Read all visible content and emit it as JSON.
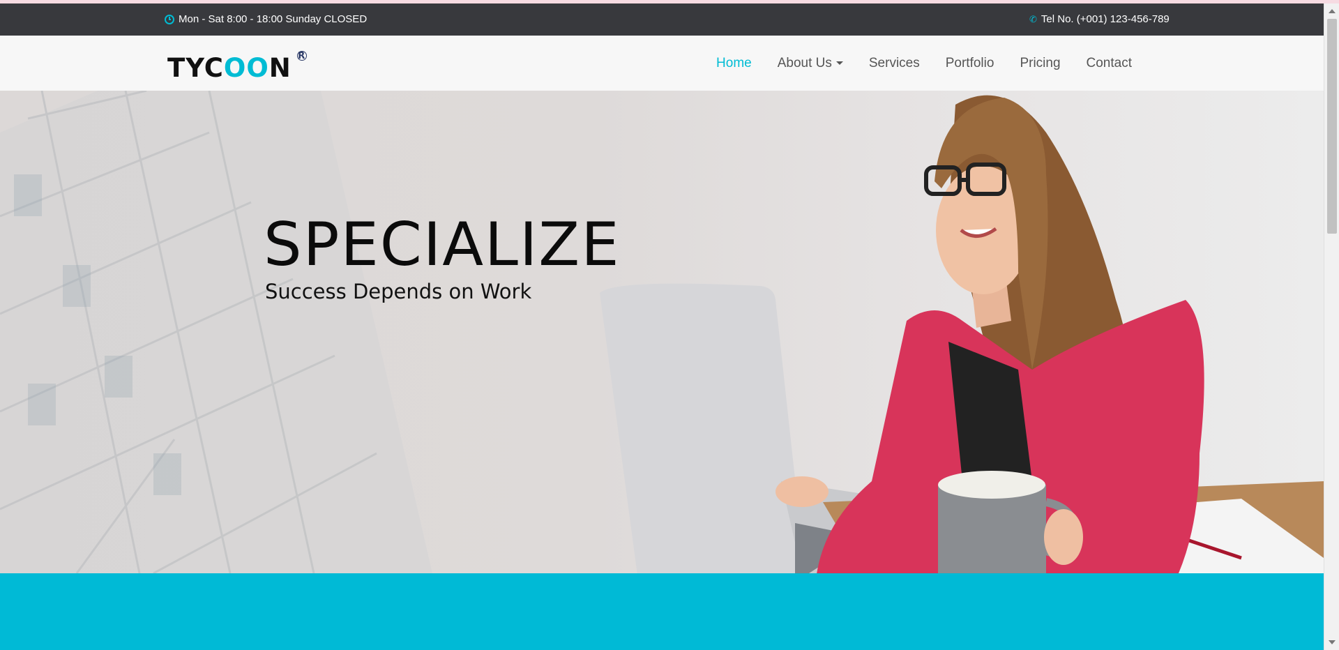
{
  "topbar": {
    "hours": "Mon - Sat 8:00 - 18:00 Sunday CLOSED",
    "phone": "Tel No. (+001) 123-456-789",
    "hours_icon": "clock-icon",
    "phone_icon": "phone-icon"
  },
  "brand": {
    "prefix": "TYC",
    "accent": "OO",
    "suffix": "N",
    "registered_mark": "R"
  },
  "nav": {
    "items": [
      {
        "label": "Home",
        "active": true
      },
      {
        "label": "About Us",
        "dropdown": true
      },
      {
        "label": "Services"
      },
      {
        "label": "Portfolio"
      },
      {
        "label": "Pricing"
      },
      {
        "label": "Contact"
      }
    ]
  },
  "hero": {
    "title": "SPECIALIZE",
    "subtitle": "Success Depends on Work"
  },
  "colors": {
    "accent": "#00bcd4",
    "topbar_bg": "#38393d",
    "band_bg": "#00bad6",
    "jacket": "#d8345a"
  }
}
